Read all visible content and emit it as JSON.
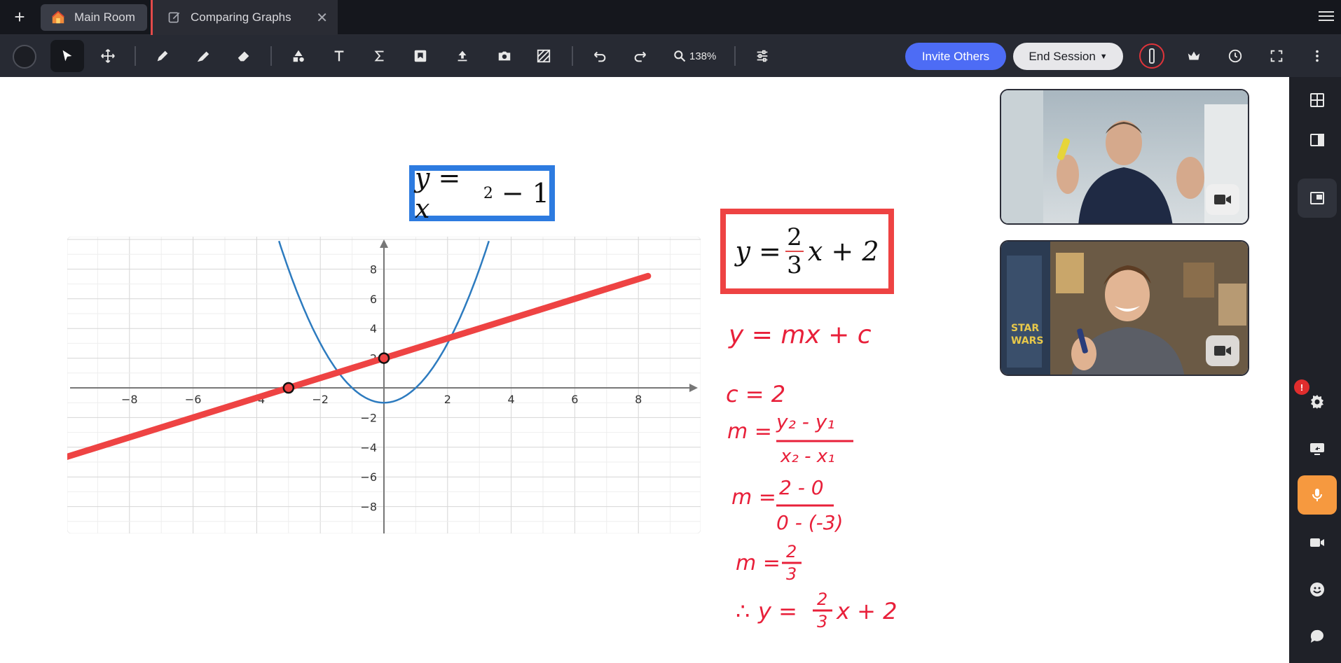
{
  "tabs": {
    "add_label": "+",
    "main_room": "Main Room",
    "active": "Comparing Graphs",
    "close_label": "✕"
  },
  "toolbar": {
    "zoom": "138%",
    "invite": "Invite Others",
    "end_session": "End Session",
    "tools": [
      "select-icon",
      "move-icon",
      "pen-icon",
      "highlighter-icon",
      "eraser-icon",
      "shapes-icon",
      "text-icon",
      "sigma-icon",
      "sticky-note-icon",
      "upload-icon",
      "camera-icon",
      "hatch-fill-icon",
      "undo-icon",
      "redo-icon",
      "settings-sliders-icon"
    ]
  },
  "formulas": {
    "blue_lhs": "y = x",
    "blue_exp": "2",
    "blue_rhs": " − 1",
    "red_lhs": "y =",
    "red_num": "2",
    "red_den": "3",
    "red_rhs": "x + 2"
  },
  "handwriting": {
    "line1": "y = mx + c",
    "line2": "c = 2",
    "line3_label": "m =",
    "line3_num": "y₂ - y₁",
    "line3_den": "x₂ - x₁",
    "line4_label": "m =",
    "line4_num": "2 - 0",
    "line4_den": "0 - (-3)",
    "line5_label": "m =",
    "line5_num": "2",
    "line5_den": "3",
    "line6_therefore": "∴",
    "line6_lhs": "y =",
    "line6_num": "2",
    "line6_den": "3",
    "line6_rhs": "x + 2"
  },
  "chart_data": {
    "type": "line",
    "x_ticks": [
      -8,
      -6,
      -4,
      -2,
      2,
      4,
      6,
      8
    ],
    "y_ticks": [
      8,
      6,
      4,
      2,
      -2,
      -4,
      -6,
      -8
    ],
    "xlim": [
      -10,
      10
    ],
    "ylim": [
      -10,
      10
    ],
    "grid": true,
    "series": [
      {
        "function": "y = x^2 - 1",
        "color": "#2d7bbf"
      },
      {
        "function": "y = 2/3 x + 2",
        "color": "#ee4343"
      }
    ],
    "points": [
      {
        "x": -3,
        "y": 0
      },
      {
        "x": 0,
        "y": 2
      }
    ]
  },
  "colors": {
    "accent": "#4d6cf5",
    "mic": "#f6993f",
    "ink_red": "#e8203a"
  },
  "sidebar": {
    "badge": "!",
    "icons": [
      "layout-grid-icon",
      "sidebar-right-icon",
      "picture-in-picture-icon",
      "settings-icon",
      "screen-share-icon",
      "microphone-icon",
      "video-camera-icon",
      "emoji-icon",
      "chat-icon"
    ]
  }
}
